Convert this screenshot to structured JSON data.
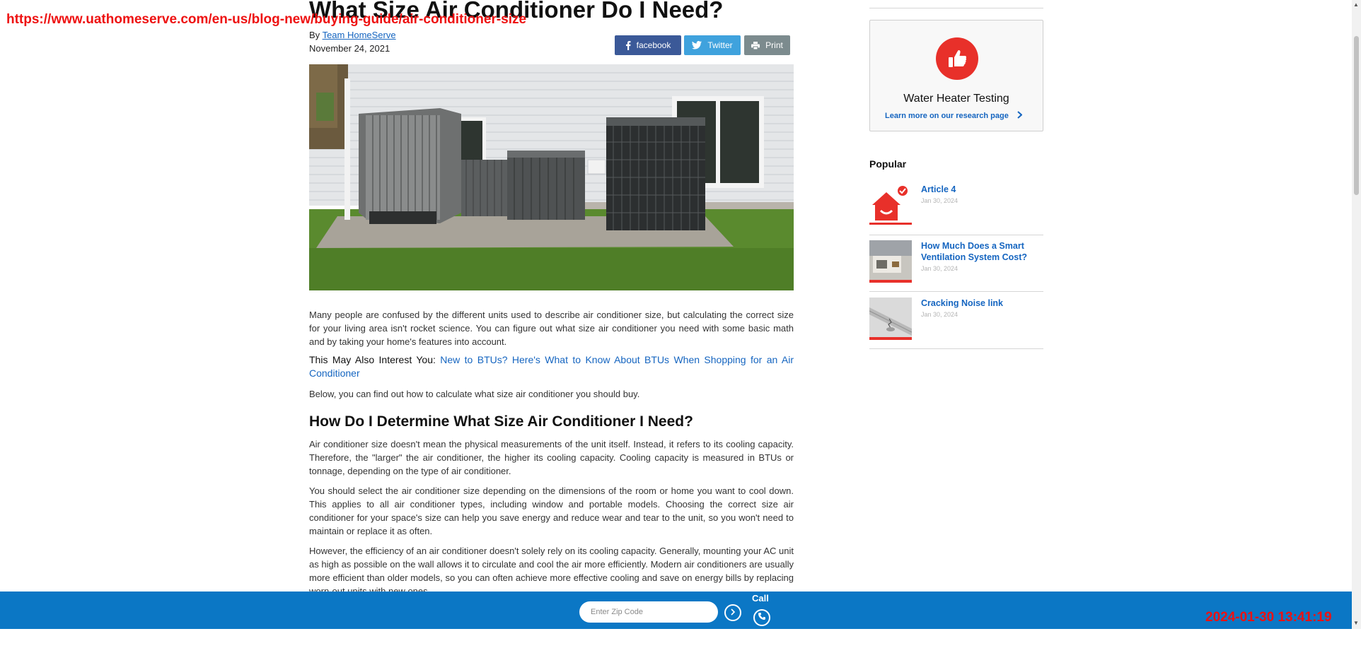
{
  "browser": {
    "url": "https://www.uathomeserve.com/en-us/blog-new/buying-guide/air-conditioner-size",
    "timestamp": "2024-01-30 13:41:19"
  },
  "article": {
    "title": "What Size Air Conditioner Do I Need?",
    "byline_prefix": "By",
    "author": "Team HomeServe",
    "date": "November 24, 2021",
    "share": {
      "facebook": "facebook",
      "twitter": "Twitter",
      "print": "Print"
    },
    "p1": "Many people are confused by the different units used to describe air conditioner size, but calculating the correct size for your living area isn't rocket science. You can figure out what size air conditioner you need with some basic math and by taking your home's features into account.",
    "interest_label": "This May Also Interest You:",
    "interest_link": "New to BTUs? Here's What to Know About BTUs When Shopping for an Air Conditioner",
    "p3": "Below, you can find out how to calculate what size air conditioner you should buy.",
    "h2": "How Do I Determine What Size Air Conditioner I Need?",
    "p4": "Air conditioner size doesn't mean the physical measurements of the unit itself. Instead, it refers to its cooling capacity. Therefore, the \"larger\" the air conditioner, the higher its cooling capacity. Cooling capacity is measured in BTUs or tonnage, depending on the type of air conditioner.",
    "p5": "You should select the air conditioner size depending on the dimensions of the room or home you want to cool down. This applies to all air conditioner types, including window and portable models. Choosing the correct size air conditioner for your space's size can help you save energy and reduce wear and tear to the unit, so you won't need to maintain or replace it as often.",
    "p6": "However, the efficiency of an air conditioner doesn't solely rely on its cooling capacity. Generally, mounting your AC unit as high as possible on the wall allows it to circulate and cool the air more efficiently. Modern air conditioners are usually more efficient than older models, so you can often achieve more effective cooling and save on energy bills by replacing worn-out units with new ones."
  },
  "sidebar": {
    "card": {
      "title": "Water Heater Testing",
      "link": "Learn more on our research page"
    },
    "popular_heading": "Popular",
    "popular": [
      {
        "title": "Article 4",
        "date": "Jan 30, 2024"
      },
      {
        "title": "How Much Does a Smart Ventilation System Cost?",
        "date": "Jan 30, 2024"
      },
      {
        "title": "Cracking Noise link",
        "date": "Jan 30, 2024"
      }
    ]
  },
  "bottom_bar": {
    "zip_placeholder": "Enter Zip Code",
    "call_label": "Call"
  },
  "colors": {
    "accent_blue": "#0b77c5",
    "link_blue": "#1565c0",
    "brand_red": "#e8302a",
    "facebook": "#3b5998",
    "twitter": "#3fa2dd",
    "print": "#7c8b8e",
    "overlay_red": "#ee1111"
  }
}
